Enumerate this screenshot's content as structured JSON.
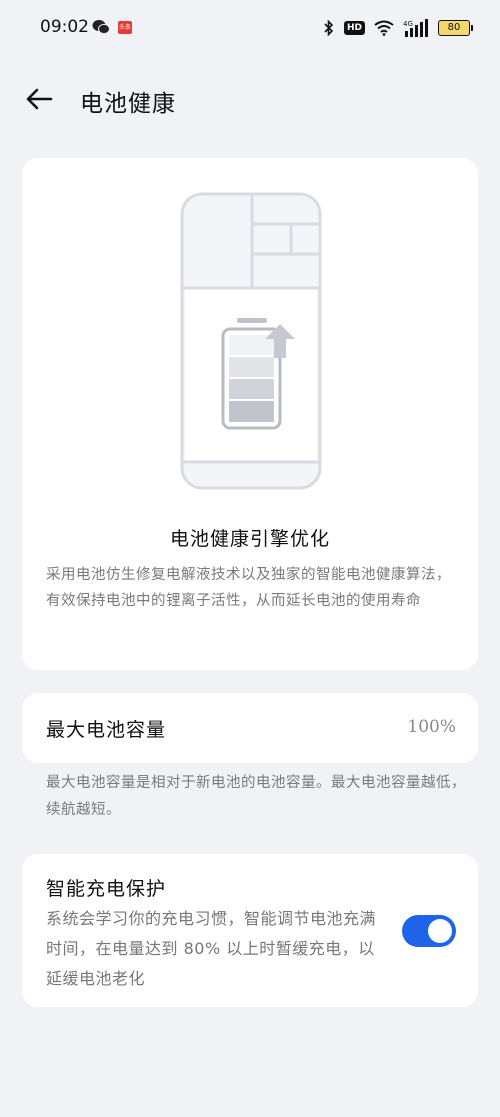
{
  "status_bar": {
    "time": "09:02",
    "news_icon_text": "头条",
    "battery_level": "80",
    "network": "4G",
    "hd_label": "HD",
    "icons": [
      "wechat-icon",
      "toutiao-icon",
      "bluetooth-icon",
      "hd-icon",
      "wifi-icon",
      "signal-icon",
      "battery-icon"
    ]
  },
  "header": {
    "title": "电池健康",
    "back_icon": "back-arrow-icon"
  },
  "engine_card": {
    "title": "电池健康引擎优化",
    "description": "采用电池仿生修复电解液技术以及独家的智能电池健康算法，有效保持电池中的锂离子活性，从而延长电池的使用寿命",
    "illustration": "phone-battery-illustration"
  },
  "capacity_card": {
    "label": "最大电池容量",
    "value": "100%"
  },
  "capacity_note": "最大电池容量是相对于新电池的电池容量。最大电池容量越低，续航越短。",
  "protect_card": {
    "title": "智能充电保护",
    "description": "系统会学习你的充电习惯，智能调节电池充满时间，在电量达到 80% 以上时暂缓充电，以延缓电池老化",
    "enabled": true
  },
  "colors": {
    "accent": "#1f63e8",
    "background": "#f1f2f6",
    "card": "#ffffff"
  }
}
